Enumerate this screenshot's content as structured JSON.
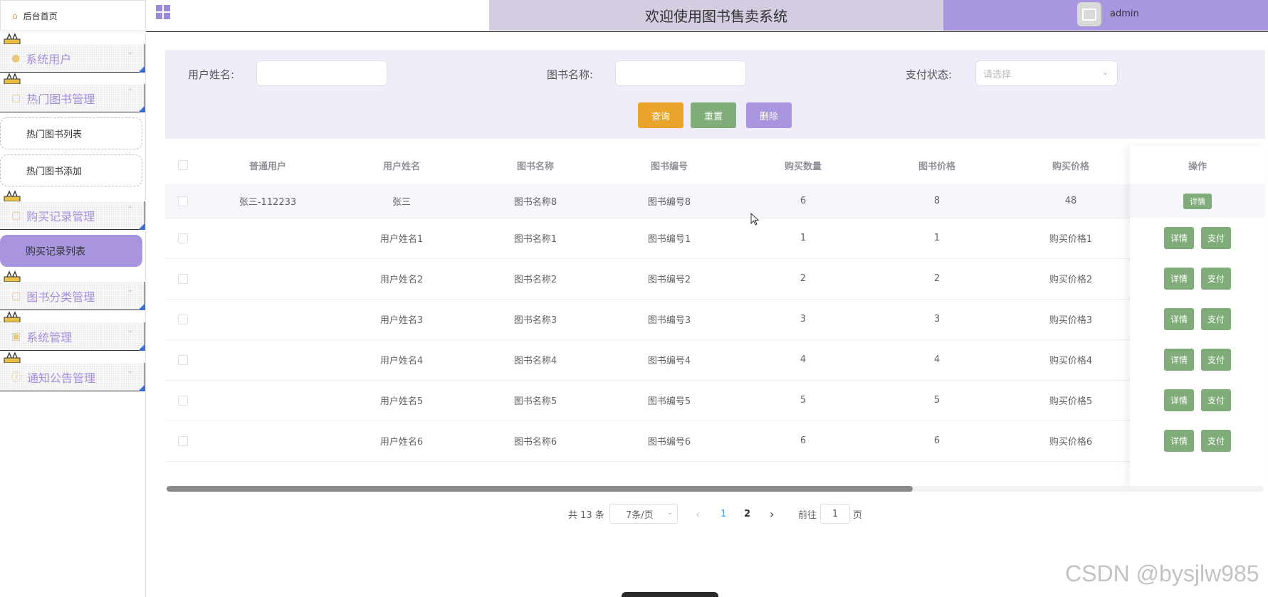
{
  "sidebar": {
    "home_label": "后台首页",
    "groups": [
      {
        "label": "系统用户"
      },
      {
        "label": "热门图书管理"
      },
      {
        "label": "购买记录管理"
      },
      {
        "label": "图书分类管理"
      },
      {
        "label": "系统管理"
      },
      {
        "label": "通知公告管理"
      }
    ],
    "sub_items": [
      {
        "label": "热门图书列表"
      },
      {
        "label": "热门图书添加"
      },
      {
        "label": "购买记录列表"
      }
    ]
  },
  "header": {
    "title": "欢迎使用图书售卖系统",
    "username": "admin"
  },
  "search": {
    "user_name_label": "用户姓名:",
    "book_name_label": "图书名称:",
    "pay_status_label": "支付状态:",
    "pay_status_placeholder": "请选择",
    "query_button": "查询",
    "reset_button": "重置",
    "delete_button": "删除"
  },
  "colors": {
    "accent": "#a896de",
    "query": "#eba42b",
    "reset": "#7fac78",
    "delete": "#a994e0"
  },
  "table": {
    "columns": [
      "普通用户",
      "用户姓名",
      "图书名称",
      "图书编号",
      "购买数量",
      "图书价格",
      "购买价格",
      "操作"
    ],
    "rows": [
      {
        "c0": "张三-112233",
        "c1": "张三",
        "c2": "图书名称8",
        "c3": "图书编号8",
        "c4": "6",
        "c5": "8",
        "c6": "48"
      },
      {
        "c0": "",
        "c1": "用户姓名1",
        "c2": "图书名称1",
        "c3": "图书编号1",
        "c4": "1",
        "c5": "1",
        "c6": "购买价格1"
      },
      {
        "c0": "",
        "c1": "用户姓名2",
        "c2": "图书名称2",
        "c3": "图书编号2",
        "c4": "2",
        "c5": "2",
        "c6": "购买价格2"
      },
      {
        "c0": "",
        "c1": "用户姓名3",
        "c2": "图书名称3",
        "c3": "图书编号3",
        "c4": "3",
        "c5": "3",
        "c6": "购买价格3"
      },
      {
        "c0": "",
        "c1": "用户姓名4",
        "c2": "图书名称4",
        "c3": "图书编号4",
        "c4": "4",
        "c5": "4",
        "c6": "购买价格4"
      },
      {
        "c0": "",
        "c1": "用户姓名5",
        "c2": "图书名称5",
        "c3": "图书编号5",
        "c4": "5",
        "c5": "5",
        "c6": "购买价格5"
      },
      {
        "c0": "",
        "c1": "用户姓名6",
        "c2": "图书名称6",
        "c3": "图书编号6",
        "c4": "6",
        "c5": "6",
        "c6": "购买价格6"
      }
    ],
    "detail_label": "详情",
    "pay_label": "支付"
  },
  "pagination": {
    "total_text": "共 13 条",
    "page_size": "7条/页",
    "prev": "‹",
    "next": "›",
    "pages": [
      "1",
      "2"
    ],
    "current_page": "1",
    "goto_label": "前往",
    "goto_value": "1",
    "page_suffix": "页"
  },
  "watermark": "CSDN @bysjlw985"
}
